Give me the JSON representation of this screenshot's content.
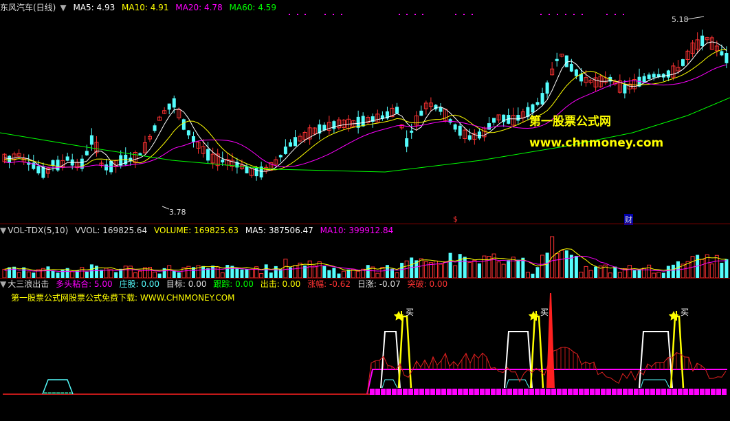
{
  "header_main": {
    "title": "东风汽车(日线)",
    "ma5": "MA5: 4.93",
    "ma10": "MA10: 4.91",
    "ma20": "MA20: 4.78",
    "ma60": "MA60: 4.59"
  },
  "price_labels": {
    "high": "5.18",
    "low": "3.78",
    "marker_s": "$",
    "marker_cai": "财"
  },
  "watermark": {
    "line1": "第一股票公式网",
    "line2": "www.chnmoney.com"
  },
  "header_vol": {
    "name": "VOL-TDX(5,10)",
    "vvol": "VVOL: 169825.64",
    "volume": "VOLUME: 169825.63",
    "ma5": "MA5: 387506.47",
    "ma10": "MA10: 399912.84"
  },
  "header_ind": {
    "name": "大三浪出击",
    "a": "多头粘合: 5.00",
    "b": "庄股: 0.00",
    "c": "目标: 0.00",
    "d": "跟踪: 0.00",
    "e": "出击: 0.00",
    "f": "涨幅: -0.62",
    "g": "日涨: -0.07",
    "h": "突破: 0.00"
  },
  "ind_note": "第一股票公式网股票公式免费下载: WWW.CHNMONEY.COM",
  "buy_label": "买",
  "colors": {
    "up": "#ff3232",
    "down": "#54fcfc",
    "ma5": "#ffffff",
    "ma10": "#ffff00",
    "ma20": "#ff00ff",
    "ma60": "#00ff00",
    "magenta": "#ff00ff"
  }
}
